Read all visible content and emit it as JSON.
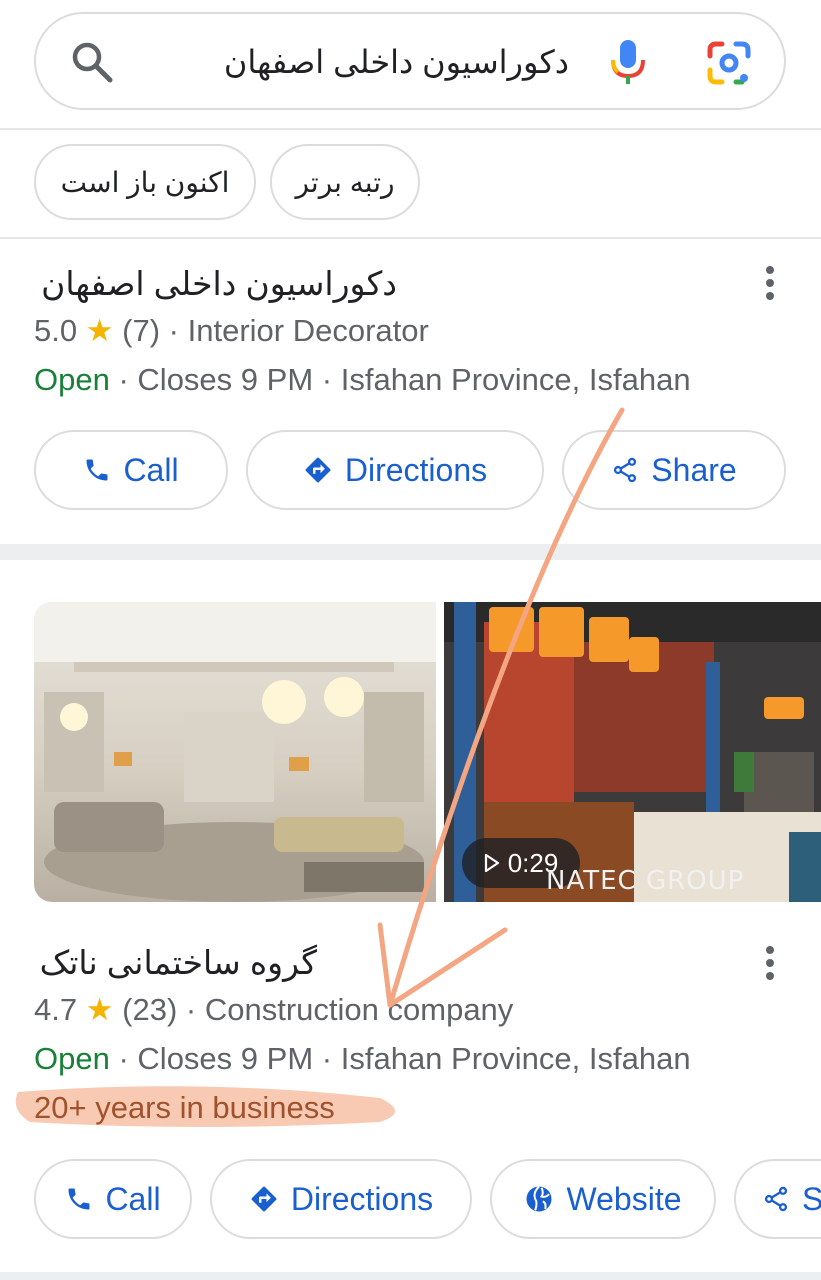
{
  "search": {
    "query": "دکوراسیون داخلی اصفهان"
  },
  "chips": [
    {
      "label": "اکنون باز است"
    },
    {
      "label": "رتبه برتر"
    }
  ],
  "results": [
    {
      "title": "دکوراسیون داخلی اصفهان",
      "rating": "5.0",
      "reviews": "(7)",
      "category": "Interior Decorator",
      "status": "Open",
      "closes": "Closes 9 PM",
      "location": "Isfahan Province, Isfahan",
      "actions": {
        "call": "Call",
        "directions": "Directions",
        "share": "Share"
      }
    },
    {
      "title": "گروه ساختمانی ناتک",
      "rating": "4.7",
      "reviews": "(23)",
      "category": "Construction company",
      "status": "Open",
      "closes": "Closes 9 PM",
      "location": "Isfahan Province, Isfahan",
      "years": "20+ years in business",
      "video_duration": "0:29",
      "photo_watermark": "NATEC GROUP",
      "actions": {
        "call": "Call",
        "directions": "Directions",
        "website": "Website",
        "share": "S"
      }
    }
  ],
  "symbols": {
    "star": "★",
    "dot": "·"
  },
  "colors": {
    "accent": "#1a5fd0",
    "open": "#188038",
    "star": "#f4b400",
    "annotation": "#f4a582"
  }
}
